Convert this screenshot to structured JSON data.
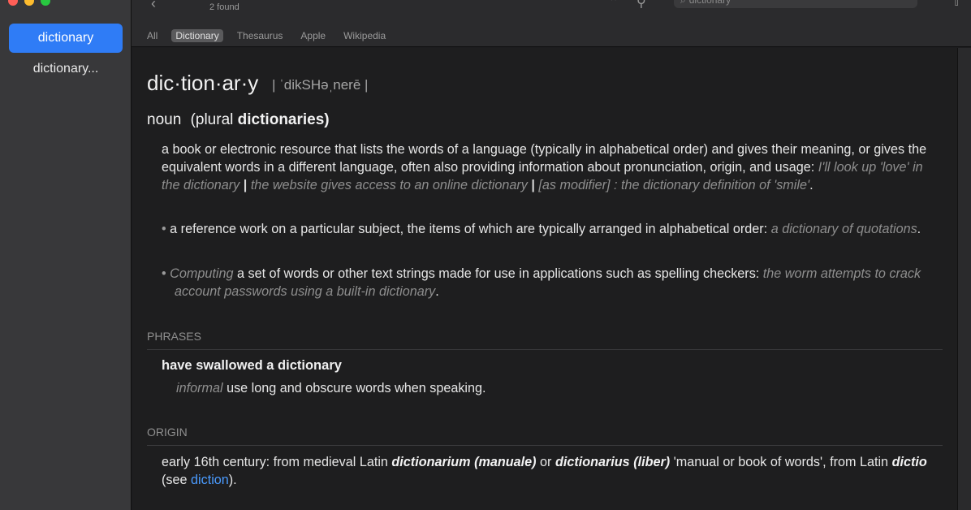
{
  "toolbar": {
    "found_text": "2 found",
    "search_value": "dictionary"
  },
  "sidebar": {
    "items": [
      {
        "label": "dictionary"
      },
      {
        "label": "dictionary..."
      }
    ]
  },
  "tabs": [
    "All",
    "Dictionary",
    "Thesaurus",
    "Apple",
    "Wikipedia"
  ],
  "entry": {
    "headword": "dic·tion·ar·y",
    "pronunciation": "| ˈdikSHəˌnerē |",
    "pos": "noun",
    "plural_label": "(plural",
    "plural_form": "dictionaries)",
    "def1": {
      "text": "a book or electronic resource that lists the words of a language (typically in alphabetical order) and gives their meaning, or gives the equivalent words in a different language, often also providing information about pronunciation, origin, and usage:",
      "ex1": "I'll look up 'love' in the dictionary",
      "ex2": "the website gives access to an online dictionary",
      "ex3": "[as modifier] : the dictionary definition of 'smile'",
      "sep": "|",
      "end": "."
    },
    "def2": {
      "bullet": "•",
      "text": "a reference work on a particular subject, the items of which are typically arranged in alphabetical order:",
      "ex": "a dictionary of quotations",
      "end": "."
    },
    "def3": {
      "bullet": "•",
      "subject": "Computing",
      "text": "a set of words or other text strings made for use in applications such as spelling checkers:",
      "ex": "the worm attempts to crack account passwords using a built-in dictionary",
      "end": "."
    },
    "phrases_heading": "PHRASES",
    "phrase": "have swallowed a dictionary",
    "phrase_label": "informal",
    "phrase_def": "use long and obscure words when speaking.",
    "origin_heading": "ORIGIN",
    "origin": {
      "p1": "early 16th century: from medieval Latin",
      "w1": "dictionarium",
      "w2": "(manuale)",
      "p2": "or",
      "w3": "dictionarius",
      "w4": "(liber)",
      "p3": "'manual or book of words', from Latin",
      "w5": "dictio",
      "p4": "(see",
      "link": "diction",
      "p5": ")."
    }
  }
}
